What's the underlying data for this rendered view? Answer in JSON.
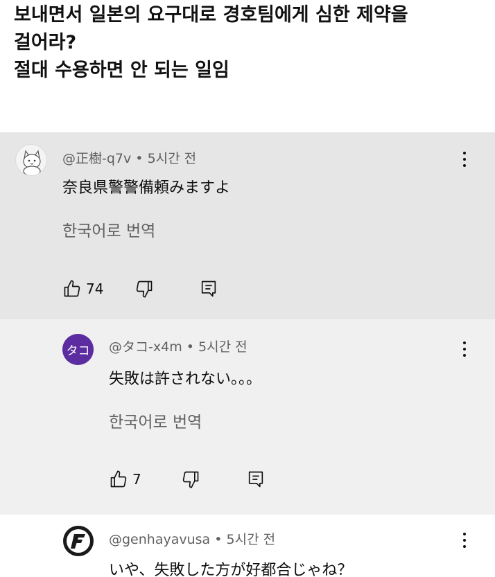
{
  "post": {
    "lines": [
      "보내면서 일본의 요구대로 경호팀에게 심한 제약을",
      "걸어라?",
      "절대 수용하면 안 되는 일임"
    ]
  },
  "comments": [
    {
      "author": "@正樹-q7v",
      "separator": "•",
      "time": "5시간 전",
      "text": "奈良県警警備頼みますよ",
      "translate_label": "한국어로 번역",
      "likes": "74"
    },
    {
      "author": "@タコ-x4m",
      "separator": "•",
      "time": "5시간 전",
      "avatar_text": "タコ",
      "text": "失敗は許されない。。。",
      "translate_label": "한국어로 번역",
      "likes": "7"
    },
    {
      "author": "@genhayavusa",
      "separator": "•",
      "time": "5시간 전",
      "text": "いや、失敗した方が好都合じゃね？"
    }
  ],
  "icons": {
    "like": "thumbs-up-icon",
    "dislike": "thumbs-down-icon",
    "reply": "reply-icon",
    "more": "more-vertical-icon"
  },
  "colors": {
    "top_comment_bg": "#e6e6e6",
    "reply_bg": "#f0f0f0",
    "meta_text": "#606060",
    "tako_avatar": "#5b2da0"
  }
}
